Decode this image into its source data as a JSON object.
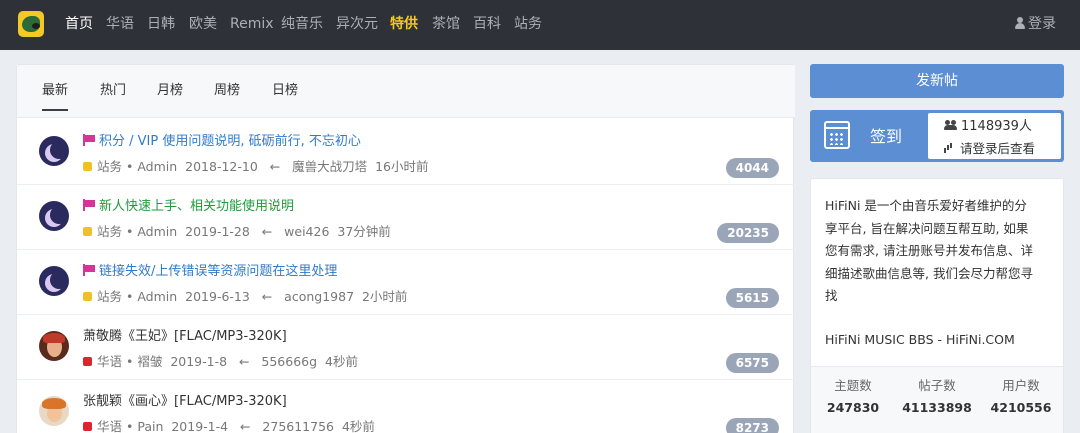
{
  "nav": {
    "items": [
      {
        "label": "首页",
        "state": "active"
      },
      {
        "label": "华语",
        "state": ""
      },
      {
        "label": "日韩",
        "state": ""
      },
      {
        "label": "欧美",
        "state": ""
      },
      {
        "label": "Remix",
        "state": ""
      },
      {
        "label": "纯音乐",
        "state": ""
      },
      {
        "label": "异次元",
        "state": ""
      },
      {
        "label": "特供",
        "state": "highlight"
      },
      {
        "label": "茶馆",
        "state": ""
      },
      {
        "label": "百科",
        "state": ""
      },
      {
        "label": "站务",
        "state": ""
      }
    ],
    "login_label": "登录"
  },
  "tabs": [
    "最新",
    "热门",
    "月榜",
    "周榜",
    "日榜"
  ],
  "threads": [
    {
      "pinned": true,
      "title": "积分 / VIP 使用问题说明, 砥砺前行, 不忘初心",
      "title_color": "blue",
      "category": "站务",
      "category_color": "#f0c02a",
      "author": "Admin",
      "date": "2018-12-10",
      "last_user": "魔兽大战刀塔",
      "last_time": "16小时前",
      "replies": "4044"
    },
    {
      "pinned": true,
      "title": "新人快速上手、相关功能使用说明",
      "title_color": "green",
      "category": "站务",
      "category_color": "#f0c02a",
      "author": "Admin",
      "date": "2019-1-28",
      "last_user": "wei426",
      "last_time": "37分钟前",
      "replies": "20235"
    },
    {
      "pinned": true,
      "title": "链接失效/上传错误等资源问题在这里处理",
      "title_color": "blue",
      "category": "站务",
      "category_color": "#f0c02a",
      "author": "Admin",
      "date": "2019-6-13",
      "last_user": "acong1987",
      "last_time": "2小时前",
      "replies": "5615"
    },
    {
      "pinned": false,
      "title": "萧敬腾《王妃》[FLAC/MP3-320K]",
      "title_color": "dark",
      "category": "华语",
      "category_color": "#e2222e",
      "author": "褶皱",
      "date": "2019-1-8",
      "last_user": "556666g",
      "last_time": "4秒前",
      "replies": "6575"
    },
    {
      "pinned": false,
      "title": "张靓颖《画心》[FLAC/MP3-320K]",
      "title_color": "dark",
      "category": "华语",
      "category_color": "#e2222e",
      "author": "Pain",
      "date": "2019-1-4",
      "last_user": "275611756",
      "last_time": "4秒前",
      "replies": "8273"
    }
  ],
  "sidebar": {
    "post_button": "发新帖",
    "checkin_label": "签到",
    "checkin_count": "1148939人",
    "checkin_sub": "请登录后查看",
    "about_lines": [
      "HiFiNi 是一个由音乐爱好者维护的分",
      "享平台, 旨在解决问题互帮互助, 如果",
      "您有需求, 请注册账号并发布信息、详",
      "细描述歌曲信息等, 我们会尽力帮您寻",
      "找"
    ],
    "about_signature": "HiFiNi MUSIC BBS - HiFiNi.COM",
    "stats": [
      {
        "label": "主题数",
        "value": "247830"
      },
      {
        "label": "帖子数",
        "value": "41133898"
      },
      {
        "label": "用户数",
        "value": "4210556"
      }
    ]
  }
}
